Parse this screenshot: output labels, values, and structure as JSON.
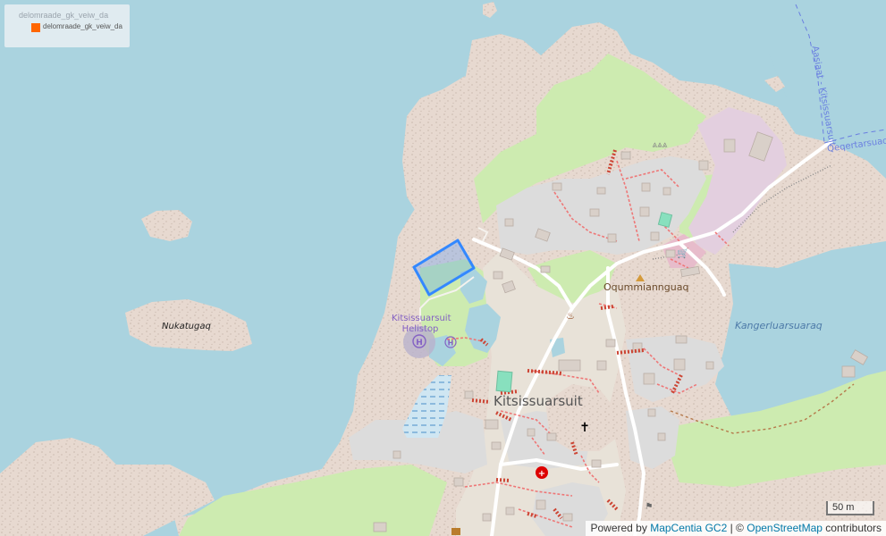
{
  "legend": {
    "title": "delomraade_gk_veiw_da",
    "item_label": "delomraade_gk_veiw_da",
    "item_color": "#ff6600"
  },
  "labels": {
    "town": "Kitsissuarsuit",
    "heliport": "Kitsissuarsuit Helistop",
    "hill": "Oqummiannguaq",
    "bay": "Kangerluarsuaraq",
    "island": "Nukatugaq",
    "ferry_route": "Aasiaat - Kitsissuarsuit",
    "coast_road": "Qeqertarsuaq"
  },
  "scale": "50 m",
  "attribution": {
    "prefix": "Powered by",
    "mapcentia": "MapCentia GC2",
    "separator": "| ©",
    "osm": "OpenStreetMap",
    "suffix": "contributors"
  },
  "colors": {
    "water": "#aad3df",
    "rock": "#e8d9d0",
    "grass": "#cdebb0",
    "urban": "#dddddd",
    "highlight": "#3388ff"
  }
}
